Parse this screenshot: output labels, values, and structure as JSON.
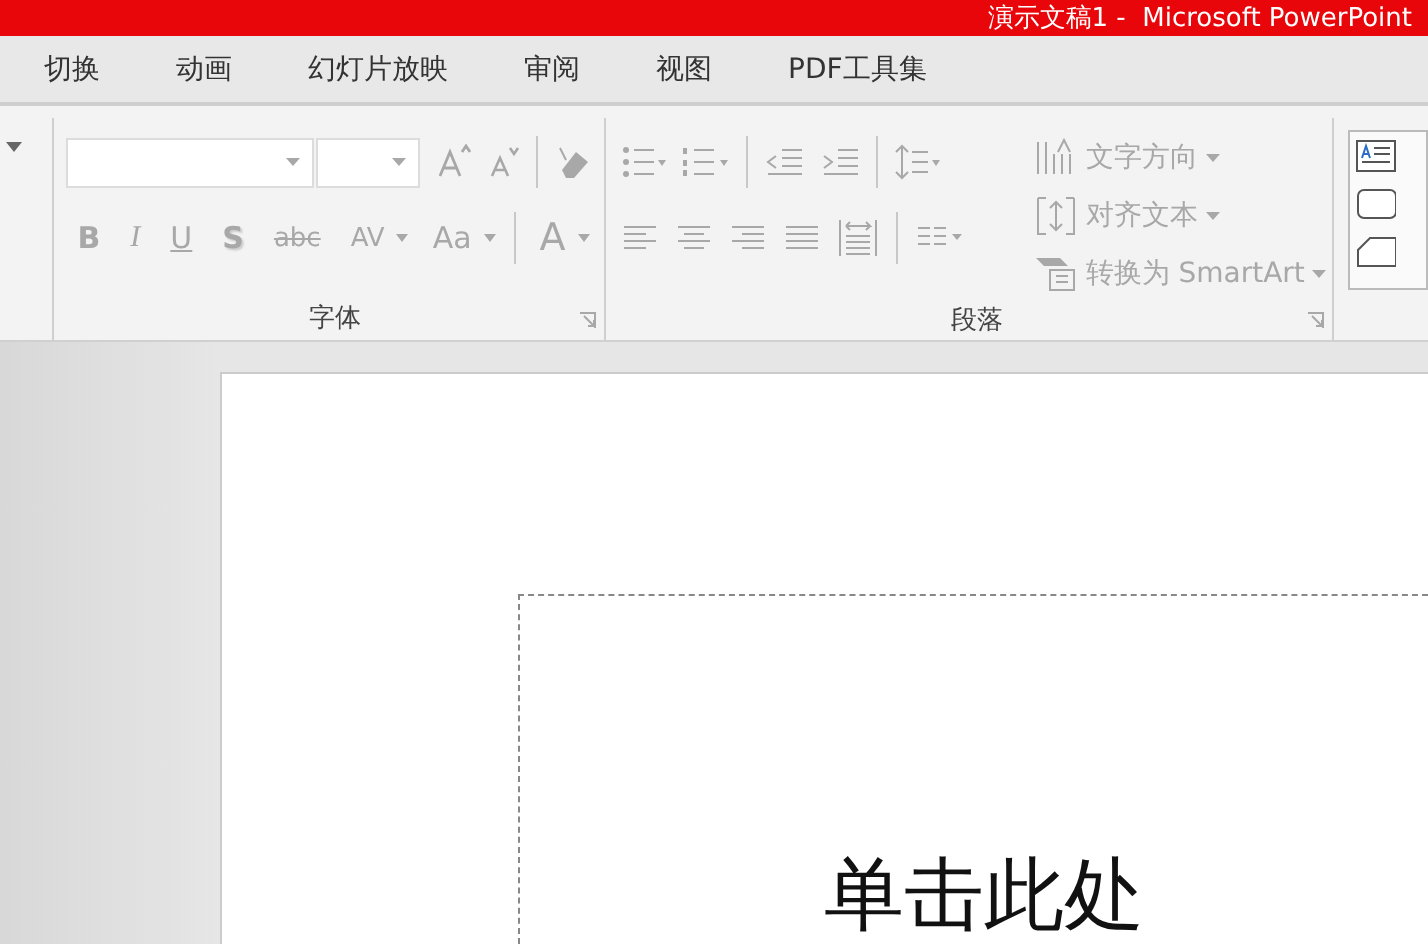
{
  "title": "演示文稿1 -  Microsoft PowerPoint",
  "tabs": [
    {
      "label": "切换",
      "selected": false
    },
    {
      "label": "动画",
      "selected": false
    },
    {
      "label": "幻灯片放映",
      "selected": false
    },
    {
      "label": "审阅",
      "selected": false
    },
    {
      "label": "视图",
      "selected": false
    },
    {
      "label": "PDF工具集",
      "selected": false
    }
  ],
  "ribbon": {
    "disabled": true,
    "font_group": {
      "label": "字体",
      "format_buttons": [
        {
          "label": "B",
          "kind": "bold"
        },
        {
          "label": "I",
          "kind": "italic"
        },
        {
          "label": "U",
          "kind": "underline"
        },
        {
          "label": "S",
          "kind": "shadow"
        },
        {
          "label": "abc",
          "kind": "strikethrough"
        },
        {
          "label": "AV",
          "kind": "spacing"
        },
        {
          "label": "Aa",
          "kind": "case"
        },
        {
          "label": "A",
          "kind": "color"
        }
      ]
    },
    "paragraph_group": {
      "label": "段落",
      "text_buttons": [
        "文字方向",
        "对齐文本",
        "转换为 SmartArt"
      ]
    }
  },
  "slide": {
    "placeholder_text": "单击此处"
  }
}
